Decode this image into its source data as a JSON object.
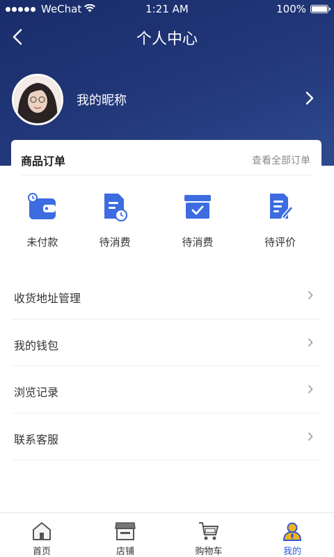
{
  "status_bar": {
    "carrier": "WeChat",
    "time": "1:21 AM",
    "battery": "100%"
  },
  "header": {
    "title": "个人中心"
  },
  "profile": {
    "nickname": "我的昵称"
  },
  "orders": {
    "title": "商品订单",
    "view_all": "查看全部订单",
    "items": [
      {
        "label": "未付款",
        "icon": "wallet-icon"
      },
      {
        "label": "待消费",
        "icon": "document-clock-icon"
      },
      {
        "label": "待消费",
        "icon": "box-check-icon"
      },
      {
        "label": "待评价",
        "icon": "document-pen-icon"
      }
    ]
  },
  "menu": {
    "items": [
      {
        "label": "收货地址管理"
      },
      {
        "label": "我的钱包"
      },
      {
        "label": "浏览记录"
      },
      {
        "label": "联系客服"
      }
    ]
  },
  "tabbar": {
    "items": [
      {
        "label": "首页",
        "icon": "home-icon"
      },
      {
        "label": "店铺",
        "icon": "store-icon"
      },
      {
        "label": "购物车",
        "icon": "cart-icon"
      },
      {
        "label": "我的",
        "icon": "user-icon"
      }
    ],
    "active_index": 3
  },
  "colors": {
    "header_gradient_start": "#1a2c6a",
    "header_gradient_end": "#2e4a8e",
    "accent": "#2f5ad6",
    "icon_blue": "#3d6ce0"
  }
}
